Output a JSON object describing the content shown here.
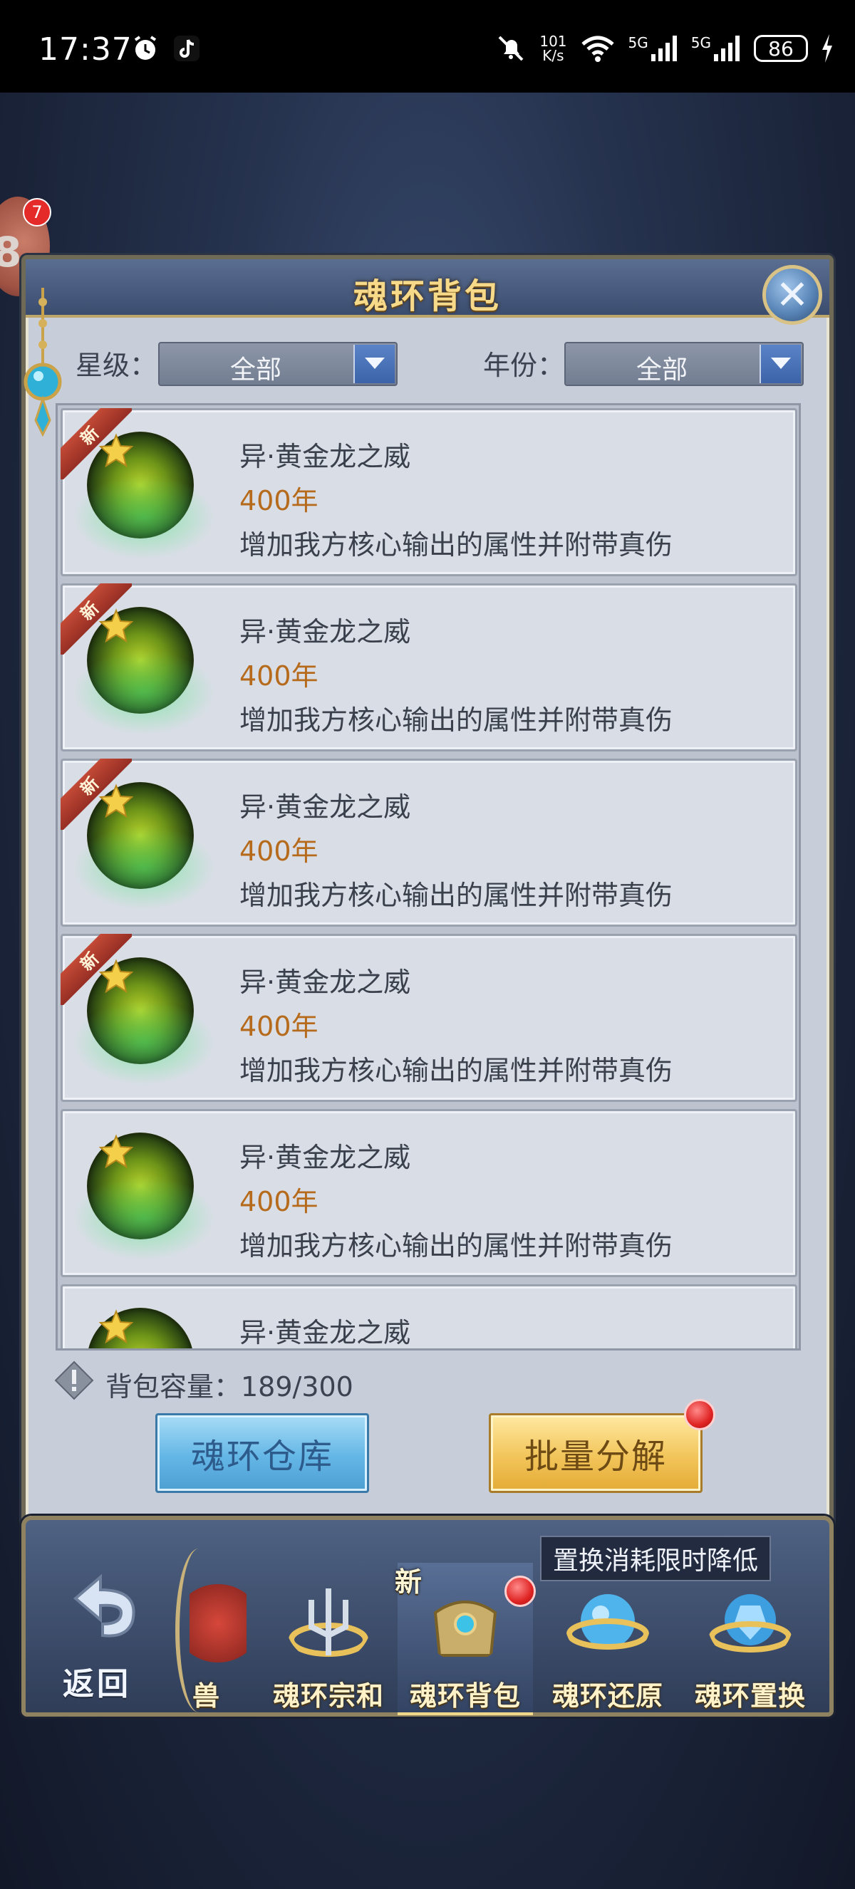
{
  "status_bar": {
    "time": "17:37",
    "net_speed_value": "101",
    "net_speed_unit": "K/s",
    "sim1": "5G",
    "sim2": "5G",
    "battery": "86"
  },
  "float_badge": {
    "count": "7",
    "glyph": "8"
  },
  "panel": {
    "title": "魂环背包",
    "filters": {
      "star_label": "星级：",
      "star_value": "全部",
      "year_label": "年份：",
      "year_value": "全部"
    },
    "items": [
      {
        "new_tag": "新",
        "name": "异·黄金龙之威",
        "years": "400年",
        "desc": "增加我方核心输出的属性并附带真伤"
      },
      {
        "new_tag": "新",
        "name": "异·黄金龙之威",
        "years": "400年",
        "desc": "增加我方核心输出的属性并附带真伤"
      },
      {
        "new_tag": "新",
        "name": "异·黄金龙之威",
        "years": "400年",
        "desc": "增加我方核心输出的属性并附带真伤"
      },
      {
        "new_tag": "新",
        "name": "异·黄金龙之威",
        "years": "400年",
        "desc": "增加我方核心输出的属性并附带真伤"
      },
      {
        "new_tag": "",
        "name": "异·黄金龙之威",
        "years": "400年",
        "desc": "增加我方核心输出的属性并附带真伤"
      },
      {
        "new_tag": "",
        "name": "异·黄金龙之威",
        "years": "",
        "desc": ""
      }
    ],
    "capacity": "背包容量：189/300",
    "buttons": {
      "warehouse": "魂环仓库",
      "batch_decompose": "批量分解"
    }
  },
  "bottom_nav": {
    "back_label": "返回",
    "items": [
      {
        "label": "兽"
      },
      {
        "label": "魂环宗和"
      },
      {
        "label": "魂环背包",
        "tag": "新"
      },
      {
        "label": "魂环还原"
      },
      {
        "label": "魂环置换"
      }
    ],
    "tooltip": "置换消耗限时降低"
  },
  "colors": {
    "title_gold": "#f7d98a",
    "years_orange": "#b66a1c",
    "new_ribbon_red": "#c34a36",
    "button_blue": "#63b6e6",
    "button_gold": "#f2c55a"
  }
}
